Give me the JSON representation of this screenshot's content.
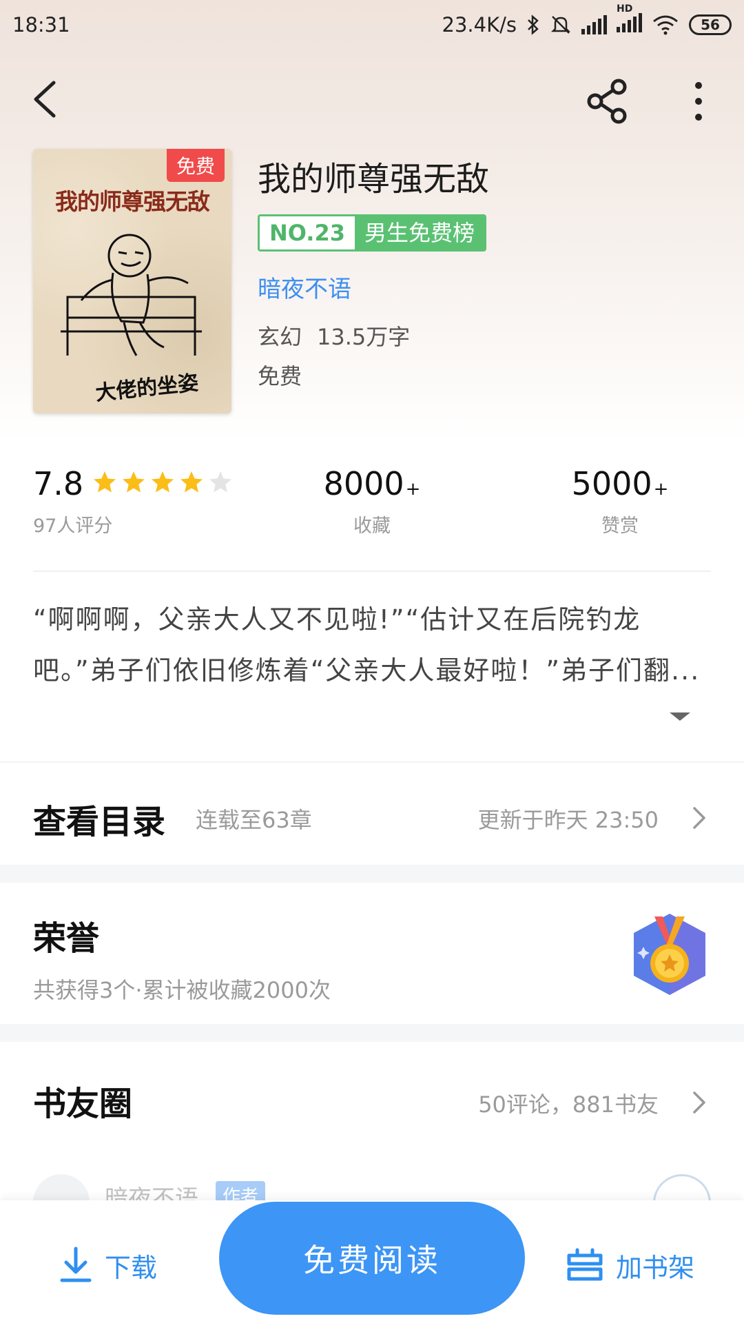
{
  "status_bar": {
    "time": "18:31",
    "net_speed": "23.4K/s",
    "battery": "56",
    "hd_label": "HD"
  },
  "nav": {
    "back_icon": "chevron-left-icon",
    "share_icon": "share-icon",
    "more_icon": "more-vertical-icon"
  },
  "book": {
    "cover": {
      "badge": "免费",
      "title": "我的师尊强无敌",
      "subtitle": "大佬的坐姿"
    },
    "title": "我的师尊强无敌",
    "rank_no": "NO.23",
    "rank_name": "男生免费榜",
    "author": "暗夜不语",
    "genre": "玄幻",
    "word_count": "13.5万字",
    "price": "免费"
  },
  "stats": {
    "score": "7.8",
    "stars_filled": 4,
    "stars_total": 5,
    "rating_count_label": "97人评分",
    "favorites": "8000",
    "favorites_plus": "+",
    "favorites_label": "收藏",
    "rewards": "5000",
    "rewards_plus": "+",
    "rewards_label": "赞赏",
    "star_color": "#fbbd17"
  },
  "intro": {
    "text": "“啊啊啊，父亲大人又不见啦!”“估计又在后院钓龙吧。”弟子们依旧修炼着“父亲大人最好啦！”弟子们翻..."
  },
  "catalog": {
    "title": "查看目录",
    "status": "连载至63章",
    "update": "更新于昨天 23:50"
  },
  "honor": {
    "title": "荣誉",
    "desc": "共获得3个·累计被收藏2000次"
  },
  "circle": {
    "title": "书友圈",
    "stats": "50评论，881书友",
    "peek_name": "暗夜不语",
    "peek_tag": "作者"
  },
  "bottom_bar": {
    "download": "下载",
    "read": "免费阅读",
    "add_shelf": "加书架"
  },
  "colors": {
    "accent": "#3d95f5",
    "rank_green": "#5ac173",
    "badge_red": "#f04a4a"
  }
}
